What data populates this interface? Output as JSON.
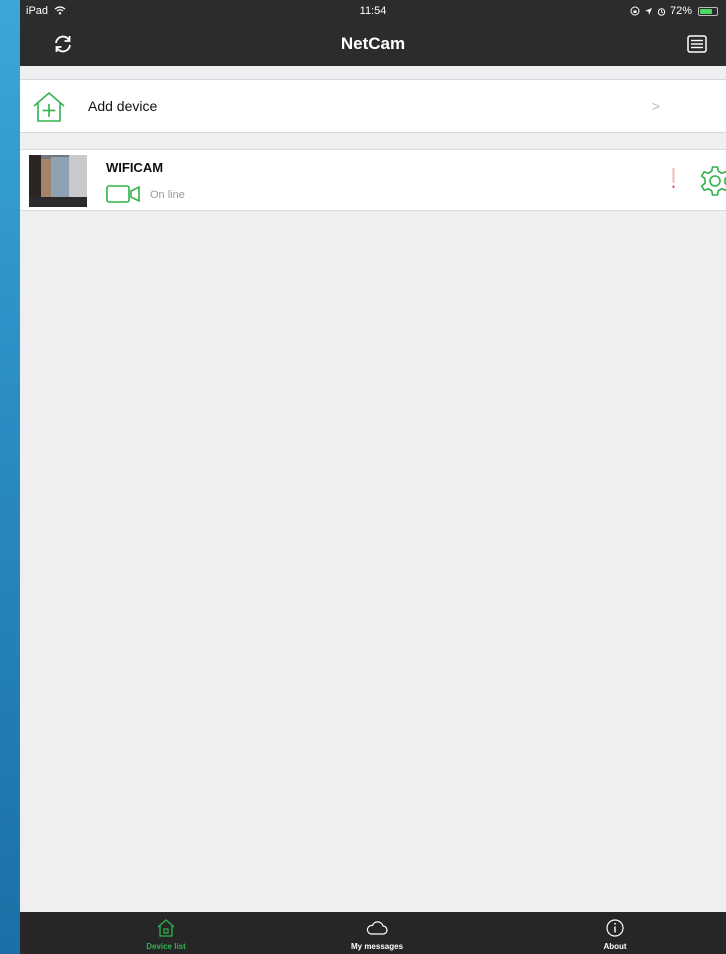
{
  "status_bar": {
    "device": "iPad",
    "wifi_icon": "wifi-icon",
    "time": "11:54",
    "battery_percent": "72%",
    "battery_level": 0.72
  },
  "nav": {
    "title": "NetCam",
    "left_icon": "refresh-icon",
    "right_icon": "list-icon"
  },
  "add_device": {
    "label": "Add device",
    "chevron": ">",
    "icon": "home-plus-icon"
  },
  "devices": [
    {
      "name": "WIFICAM",
      "status": "On line",
      "camera_icon": "camera-icon",
      "settings_icon": "gear-icon"
    }
  ],
  "tabs": [
    {
      "label": "Device list",
      "icon": "home-icon",
      "active": true
    },
    {
      "label": "My messages",
      "icon": "cloud-icon",
      "active": false
    },
    {
      "label": "About",
      "icon": "info-icon",
      "active": false
    }
  ],
  "colors": {
    "accent_green": "#30b34a",
    "bar_dark": "#2c2c2e",
    "alert_red": "#e23b3b"
  }
}
